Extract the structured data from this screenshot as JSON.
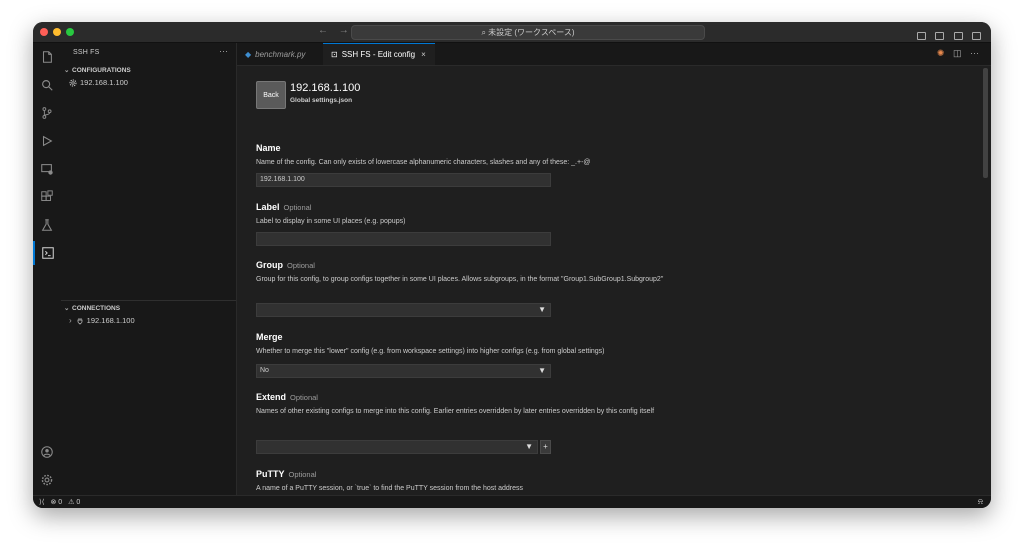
{
  "titlebar": {
    "search_text": "⌕ 未設定 (ワークスペース)",
    "back_arrow": "←",
    "forward_arrow": "→"
  },
  "sidebar": {
    "title": "SSH FS",
    "more": "···",
    "configurations_header": "CONFIGURATIONS",
    "configurations": [
      {
        "label": "192.168.1.100"
      }
    ],
    "connections_header": "CONNECTIONS",
    "connections": [
      {
        "label": "192.168.1.100"
      }
    ]
  },
  "tabs": [
    {
      "label": "benchmark.py",
      "icon": "python-file-icon",
      "active": false
    },
    {
      "label": "SSH FS - Edit config",
      "icon": "terminal-icon",
      "active": true,
      "close": "×"
    }
  ],
  "editor": {
    "back_label": "Back",
    "config_title": "192.168.1.100",
    "config_subtitle": "Global settings.json",
    "fields": {
      "name": {
        "label": "Name",
        "desc": "Name of the config. Can only exists of lowercase alphanumeric characters, slashes and any of these: _.+-@",
        "value": "192.168.1.100"
      },
      "label": {
        "label": "Label",
        "optional": "Optional",
        "desc": "Label to display in some UI places (e.g. popups)",
        "value": ""
      },
      "group": {
        "label": "Group",
        "optional": "Optional",
        "desc": "Group for this config, to group configs together in some UI places. Allows subgroups, in the format \"Group1.SubGroup1.Subgroup2\"",
        "value": ""
      },
      "merge": {
        "label": "Merge",
        "desc": "Whether to merge this \"lower\" config (e.g. from workspace settings) into higher configs (e.g. from global settings)",
        "value": "No"
      },
      "extend": {
        "label": "Extend",
        "optional": "Optional",
        "desc": "Names of other existing configs to merge into this config. Earlier entries overridden by later entries overridden by this config itself",
        "value": "",
        "add": "+"
      },
      "putty": {
        "label": "PuTTY",
        "optional": "Optional",
        "desc": "A name of a PuTTY session, or `true` to find the PuTTY session from the host address",
        "value": ""
      }
    },
    "dropdown_arrow": "▼"
  },
  "statusbar": {
    "errors": "⊗ 0",
    "warnings": "⚠ 0",
    "bell": "🔔"
  },
  "colors": {
    "accent": "#0078d4",
    "background": "#1f1f1f",
    "sidebar": "#181818"
  }
}
